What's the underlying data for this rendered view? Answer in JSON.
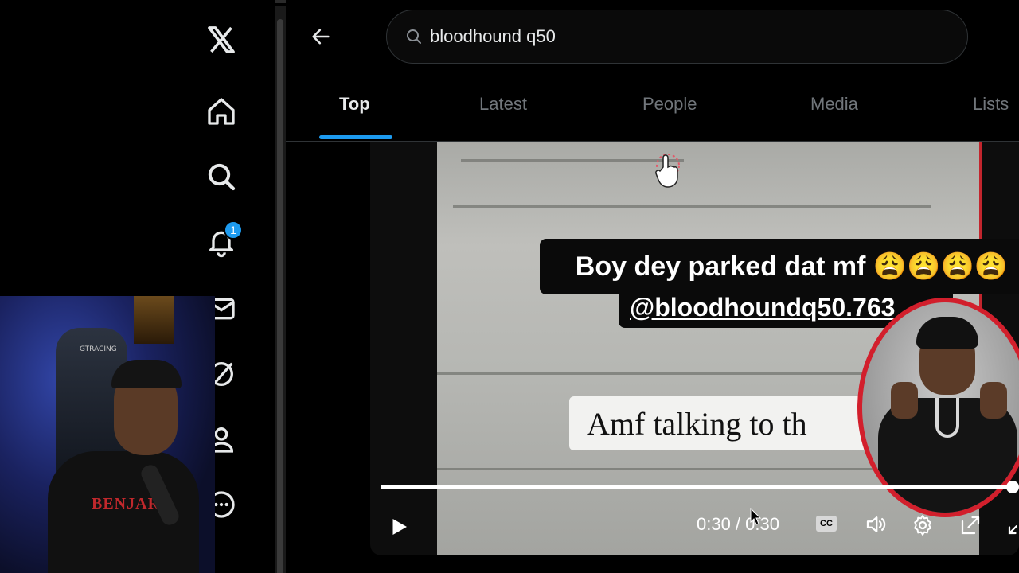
{
  "window": {
    "title": "X"
  },
  "sidebar": {
    "logo": "x-logo-icon",
    "items": [
      {
        "name": "home",
        "icon": "home-icon"
      },
      {
        "name": "explore",
        "icon": "search-icon"
      },
      {
        "name": "notifications",
        "icon": "bell-icon",
        "badge": "1"
      },
      {
        "name": "messages",
        "icon": "envelope-icon"
      },
      {
        "name": "grok",
        "icon": "grok-icon"
      },
      {
        "name": "profile",
        "icon": "person-icon"
      },
      {
        "name": "more",
        "icon": "more-circle-icon"
      }
    ]
  },
  "webcam": {
    "chair_brand": "GTRACING",
    "shirt_text": "BENJART"
  },
  "header": {
    "back_icon": "arrow-left-icon",
    "search_value": "bloodhound q50"
  },
  "tabs": [
    {
      "label": "Top",
      "active": true
    },
    {
      "label": "Latest",
      "active": false
    },
    {
      "label": "People",
      "active": false
    },
    {
      "label": "Media",
      "active": false
    },
    {
      "label": "Lists",
      "active": false
    }
  ],
  "video": {
    "caption_line1": "Boy dey parked dat mf 😩😩😩😩",
    "caption_line2": "@bloodhoundq50.763",
    "caption_bubble": "Amf talking to th",
    "time_display": "0:30 / 0:30",
    "progress": 1.0,
    "cc_label": "CC"
  },
  "colors": {
    "accent": "#1d9bf0",
    "portrait_ring": "#d21f2c",
    "background": "#000000"
  }
}
